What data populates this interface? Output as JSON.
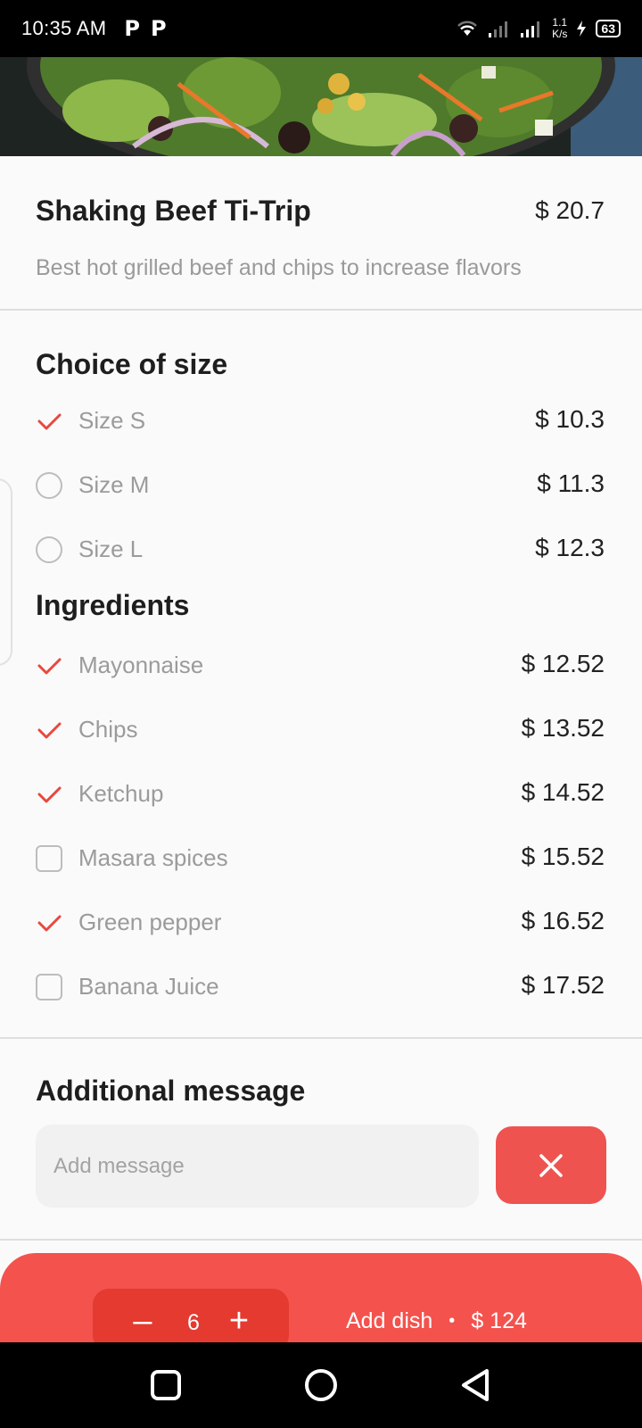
{
  "status_bar": {
    "time": "10:35 AM",
    "notif_icons": [
      "P",
      "P"
    ],
    "net_speed_top": "1.1",
    "net_speed_bottom": "K/s",
    "battery": "63"
  },
  "dish": {
    "title": "Shaking Beef Ti-Trip",
    "price": "$ 20.7",
    "description": "Best hot grilled beef and chips to increase flavors"
  },
  "size_section": {
    "title": "Choice of size",
    "options": [
      {
        "label": "Size S",
        "price": "$ 10.3",
        "selected": true
      },
      {
        "label": "Size M",
        "price": "$ 11.3",
        "selected": false
      },
      {
        "label": "Size L",
        "price": "$ 12.3",
        "selected": false
      }
    ]
  },
  "ingredients_section": {
    "title": "Ingredients",
    "options": [
      {
        "label": "Mayonnaise",
        "price": "$ 12.52",
        "checked": true
      },
      {
        "label": "Chips",
        "price": "$ 13.52",
        "checked": true
      },
      {
        "label": "Ketchup",
        "price": "$ 14.52",
        "checked": true
      },
      {
        "label": "Masara spices",
        "price": "$ 15.52",
        "checked": false
      },
      {
        "label": "Green pepper",
        "price": "$ 16.52",
        "checked": true
      },
      {
        "label": "Banana Juice",
        "price": "$ 17.52",
        "checked": false
      }
    ]
  },
  "message_section": {
    "title": "Additional message",
    "placeholder": "Add message",
    "value": ""
  },
  "bottom_bar": {
    "minus": "–",
    "quantity": "6",
    "plus": "+",
    "add_label": "Add dish",
    "separator": "•",
    "total": "$ 124"
  },
  "colors": {
    "accent": "#f4524d",
    "check": "#e8483f",
    "qty_box": "#e43a30"
  },
  "icons": {
    "check": "check-icon",
    "clear": "close-icon",
    "nav": [
      "square-icon",
      "circle-icon",
      "back-triangle-icon"
    ]
  }
}
